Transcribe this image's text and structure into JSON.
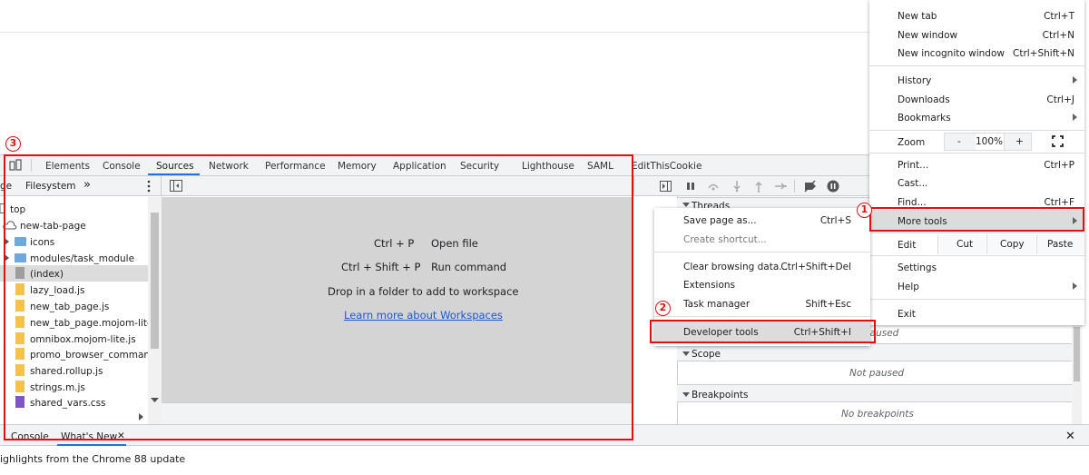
{
  "devtools": {
    "tabs": [
      "Elements",
      "Console",
      "Sources",
      "Network",
      "Performance",
      "Memory",
      "Application",
      "Security",
      "Lighthouse",
      "SAML",
      "EditThisCookie"
    ],
    "active_tab": "Sources",
    "navigator": {
      "tabs": [
        "ge",
        "Filesystem"
      ],
      "more": "»",
      "tree": [
        {
          "label": "top",
          "kind": "frame"
        },
        {
          "label": "new-tab-page",
          "kind": "cloud"
        },
        {
          "label": "icons",
          "kind": "folder"
        },
        {
          "label": "modules/task_module",
          "kind": "folder"
        },
        {
          "label": "(index)",
          "kind": "doc"
        },
        {
          "label": "lazy_load.js",
          "kind": "file"
        },
        {
          "label": "new_tab_page.js",
          "kind": "file"
        },
        {
          "label": "new_tab_page.mojom-lite.js",
          "kind": "file"
        },
        {
          "label": "omnibox.mojom-lite.js",
          "kind": "file"
        },
        {
          "label": "promo_browser_command.m",
          "kind": "file"
        },
        {
          "label": "shared.rollup.js",
          "kind": "file"
        },
        {
          "label": "strings.m.js",
          "kind": "file"
        },
        {
          "label": "shared_vars.css",
          "kind": "css"
        }
      ]
    },
    "editor": {
      "shortcut1_key": "Ctrl + P",
      "shortcut1_label": "Open file",
      "shortcut2_key": "Ctrl + Shift + P",
      "shortcut2_label": "Run command",
      "drop_text": "Drop in a folder to add to workspace",
      "learn_link": "Learn more about Workspaces"
    },
    "debugger": {
      "threads_label": "Threads",
      "paused_note_1": "paused",
      "scope_label": "Scope",
      "scope_note": "Not paused",
      "breakpoints_label": "Breakpoints",
      "breakpoints_note": "No breakpoints"
    },
    "drawer": {
      "tab_console": "Console",
      "tab_whats_new": "What's New",
      "tab_close": "✕",
      "close": "✕",
      "highlights": "ighlights from the Chrome 88 update"
    }
  },
  "main_menu": {
    "new_tab": {
      "label": "New tab",
      "shortcut": "Ctrl+T"
    },
    "new_window": {
      "label": "New window",
      "shortcut": "Ctrl+N"
    },
    "incognito": {
      "label": "New incognito window",
      "shortcut": "Ctrl+Shift+N"
    },
    "history": {
      "label": "History"
    },
    "downloads": {
      "label": "Downloads",
      "shortcut": "Ctrl+J"
    },
    "bookmarks": {
      "label": "Bookmarks"
    },
    "zoom": {
      "label": "Zoom",
      "minus": "-",
      "value": "100%",
      "plus": "+"
    },
    "print": {
      "label": "Print...",
      "shortcut": "Ctrl+P"
    },
    "cast": {
      "label": "Cast..."
    },
    "find": {
      "label": "Find...",
      "shortcut": "Ctrl+F"
    },
    "more_tools": {
      "label": "More tools"
    },
    "edit": {
      "label": "Edit",
      "cut": "Cut",
      "copy": "Copy",
      "paste": "Paste"
    },
    "settings": {
      "label": "Settings"
    },
    "help": {
      "label": "Help"
    },
    "exit": {
      "label": "Exit"
    }
  },
  "more_tools_menu": {
    "save_page": {
      "label": "Save page as...",
      "shortcut": "Ctrl+S"
    },
    "create_shortcut": {
      "label": "Create shortcut..."
    },
    "clear_data": {
      "label": "Clear browsing data...",
      "shortcut": "Ctrl+Shift+Del"
    },
    "extensions": {
      "label": "Extensions"
    },
    "task_manager": {
      "label": "Task manager",
      "shortcut": "Shift+Esc"
    },
    "developer_tools": {
      "label": "Developer tools",
      "shortcut": "Ctrl+Shift+I"
    }
  },
  "annotations": {
    "step1": "1",
    "step2": "2",
    "step3": "3"
  },
  "colors": {
    "annotation_red": "#e01010",
    "active_tab_blue": "#1a73e8",
    "link_blue": "#1a56db"
  }
}
